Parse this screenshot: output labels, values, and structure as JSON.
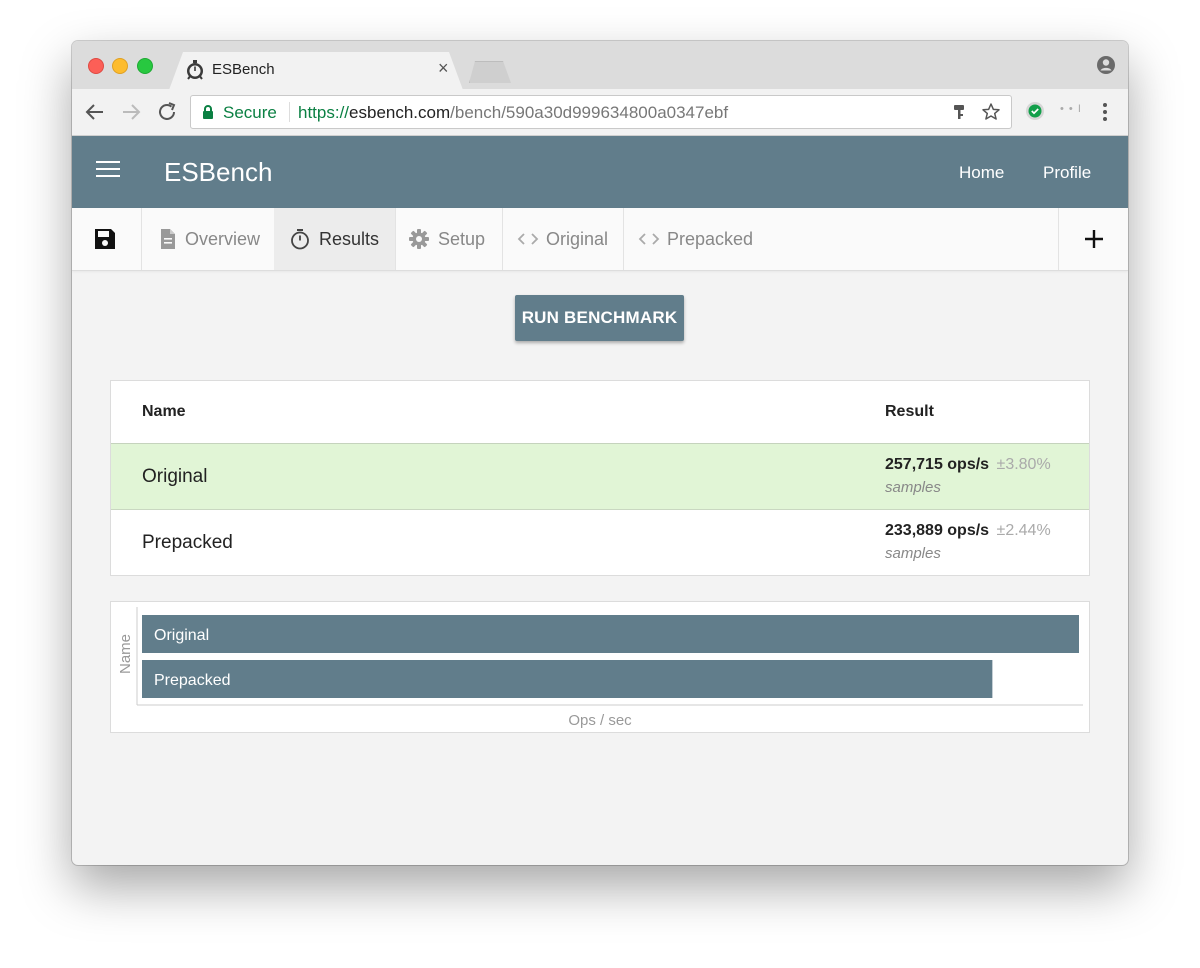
{
  "browser": {
    "tab_title": "ESBench",
    "tab_close": "×",
    "secure_label": "Secure",
    "url_scheme": "https://",
    "url_host": "esbench.com",
    "url_path": "/bench/590a30d999634800a0347ebf",
    "extension_text": "• • I"
  },
  "app": {
    "title": "ESBench",
    "nav": [
      "Home",
      "Profile"
    ]
  },
  "tabs": [
    {
      "label": "Overview",
      "icon": "document-icon",
      "active": false
    },
    {
      "label": "Results",
      "icon": "stopwatch-icon",
      "active": true
    },
    {
      "label": "Setup",
      "icon": "gear-icon",
      "active": false
    },
    {
      "label": "Original",
      "icon": "code-icon",
      "active": false
    },
    {
      "label": "Prepacked",
      "icon": "code-icon",
      "active": false
    }
  ],
  "toolbar_icons": {
    "save": "save-icon",
    "add": "plus-icon"
  },
  "run_button": "RUN BENCHMARK",
  "results_table": {
    "headers": [
      "Name",
      "Result"
    ],
    "rows": [
      {
        "name": "Original",
        "ops": "257,715 ops/s",
        "error": "±3.80%",
        "note": "samples",
        "fastest": true
      },
      {
        "name": "Prepacked",
        "ops": "233,889 ops/s",
        "error": "±2.44%",
        "note": "samples",
        "fastest": false
      }
    ]
  },
  "colors": {
    "accent": "#617d8b",
    "winner_row": "#e1f5d6"
  },
  "chart_data": {
    "type": "bar",
    "orientation": "horizontal",
    "categories": [
      "Original",
      "Prepacked"
    ],
    "values": [
      257715,
      233889
    ],
    "xlabel": "Ops / sec",
    "ylabel": "Name",
    "grid": false
  }
}
